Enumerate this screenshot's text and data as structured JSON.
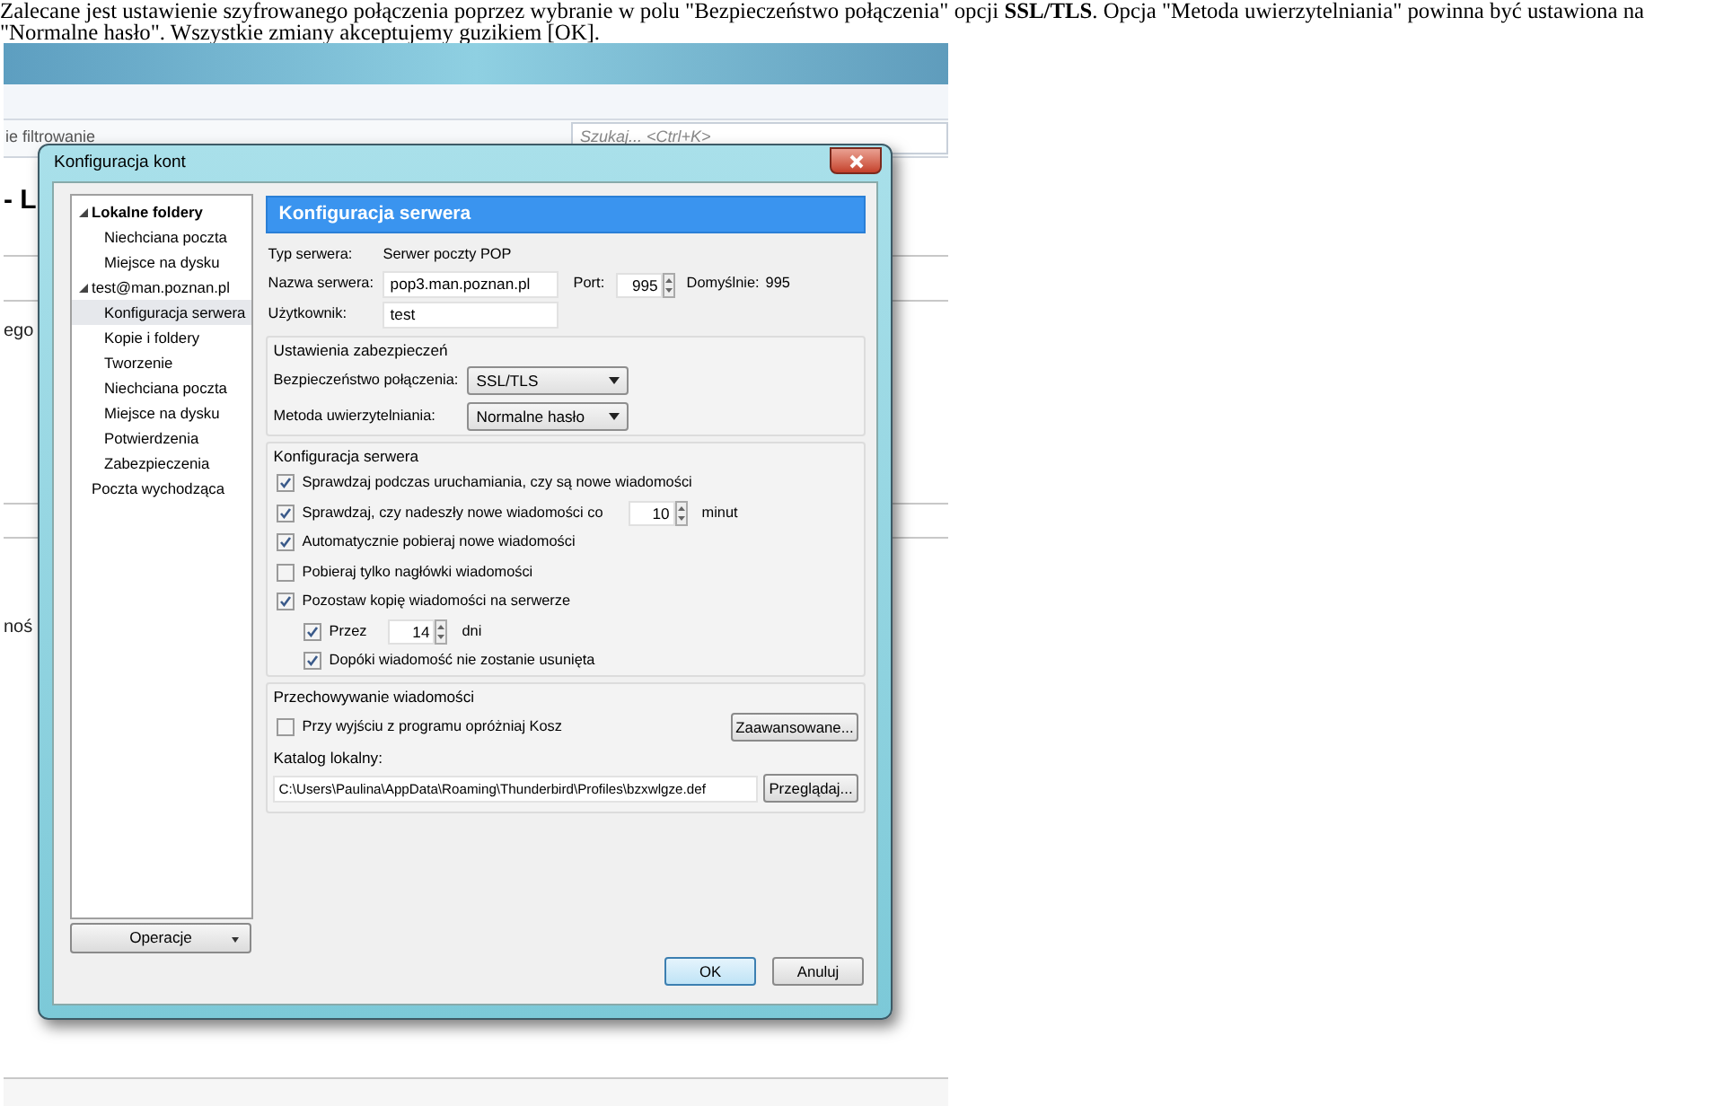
{
  "instruction": "Zalecane jest ustawienie szyfrowanego połączenia poprzez wybranie w polu \"Bezpieczeństwo połączenia\" opcji **SSL/TLS**. Opcja \"Metoda uwierzytelniania\" powinna być ustawiona na \"Normalne hasło\". Wszystkie zmiany akceptujemy guzikiem [OK].",
  "background_app": {
    "filter_label": "ie filtrowanie",
    "search_placeholder": "Szukaj... <Ctrl+K>",
    "fragments": [
      "- L",
      "ego",
      "noś"
    ]
  },
  "dialog": {
    "title": "Konfiguracja kont",
    "tree": [
      {
        "label": "Lokalne foldery",
        "bold": true,
        "expanded": true,
        "selected": false,
        "children": [
          {
            "label": "Niechciana poczta",
            "selected": false
          },
          {
            "label": "Miejsce na dysku",
            "selected": false
          }
        ]
      },
      {
        "label": "test@man.poznan.pl",
        "bold": false,
        "expanded": true,
        "selected": false,
        "children": [
          {
            "label": "Konfiguracja serwera",
            "selected": true
          },
          {
            "label": "Kopie i foldery",
            "selected": false
          },
          {
            "label": "Tworzenie",
            "selected": false
          },
          {
            "label": "Niechciana poczta",
            "selected": false
          },
          {
            "label": "Miejsce na dysku",
            "selected": false
          },
          {
            "label": "Potwierdzenia",
            "selected": false
          },
          {
            "label": "Zabezpieczenia",
            "selected": false
          }
        ]
      },
      {
        "label": "Poczta wychodząca",
        "bold": false,
        "selected": false
      }
    ],
    "operations_button": "Operacje",
    "panel_title": "Konfiguracja serwera",
    "server_type": {
      "label": "Typ serwera:",
      "value": "Serwer poczty POP"
    },
    "server_name": {
      "label": "Nazwa serwera:",
      "value": "pop3.man.poznan.pl"
    },
    "port": {
      "label": "Port:",
      "value": "995"
    },
    "default_port": {
      "label": "Domyślnie:",
      "value": "995"
    },
    "user": {
      "label": "Użytkownik:",
      "value": "test"
    },
    "security": {
      "title": "Ustawienia zabezpieczeń",
      "fields": [
        {
          "label": "Bezpieczeństwo połączenia:",
          "value": "SSL/TLS"
        },
        {
          "label": "Metoda uwierzytelniania:",
          "value": "Normalne hasło"
        }
      ]
    },
    "server_settings": {
      "title": "Konfiguracja serwera",
      "options": [
        {
          "label": "Sprawdzaj podczas uruchamiania, czy są nowe wiadomości",
          "checked": true
        },
        {
          "label": "Sprawdzaj, czy nadeszły nowe wiadomości co",
          "checked": true,
          "spin_value": "10",
          "suffix": "minut"
        },
        {
          "label": "Automatycznie pobieraj nowe wiadomości",
          "checked": true
        },
        {
          "label": "Pobieraj tylko nagłówki wiadomości",
          "checked": false
        },
        {
          "label": "Pozostaw kopię wiadomości na serwerze",
          "checked": true,
          "children": [
            {
              "label": "Przez",
              "checked": true,
              "spin_value": "14",
              "suffix": "dni"
            },
            {
              "label": "Dopóki wiadomość nie zostanie usunięta",
              "checked": true
            }
          ]
        }
      ]
    },
    "storage": {
      "title": "Przechowywanie wiadomości",
      "empty_trash": {
        "label": "Przy wyjściu z programu opróżniaj Kosz",
        "checked": false
      },
      "advanced_button": "Zaawansowane...",
      "local_dir_label": "Katalog lokalny:",
      "local_dir": "C:\\Users\\Paulina\\AppData\\Roaming\\Thunderbird\\Profiles\\bzxwlgze.def",
      "browse_button": "Przeglądaj..."
    },
    "buttons": [
      {
        "label": "OK",
        "default": true
      },
      {
        "label": "Anuluj",
        "default": false
      }
    ]
  }
}
